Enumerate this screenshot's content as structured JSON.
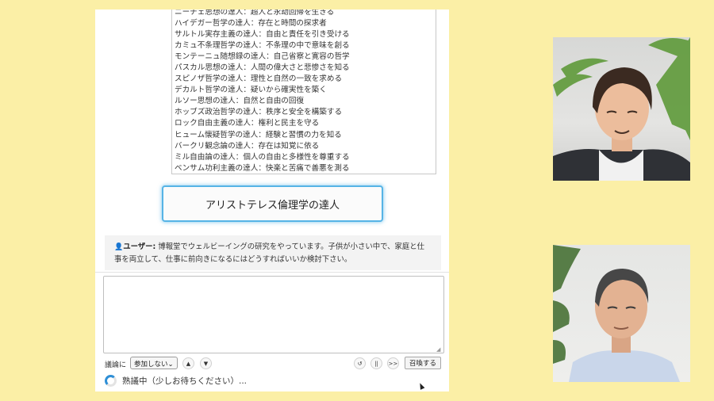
{
  "experts_list": [
    "ニーチェ思想の達人：超人と永劫回帰を生きる",
    "ハイデガー哲学の達人：存在と時間の探求者",
    "サルトル実存主義の達人：自由と責任を引き受ける",
    "カミュ不条理哲学の達人：不条理の中で意味を創る",
    "モンテーニュ随想録の達人：自己省察と寛容の哲学",
    "パスカル思想の達人：人間の偉大さと悲惨さを知る",
    "スピノザ哲学の達人：理性と自然の一致を求める",
    "デカルト哲学の達人：疑いから確実性を築く",
    "ルソー思想の達人：自然と自由の回復",
    "ホッブズ政治哲学の達人：秩序と安全を構築する",
    "ロック自由主義の達人：権利と民主を守る",
    "ヒューム懐疑哲学の達人：経験と習慣の力を知る",
    "バークリ観念論の達人：存在は知覚に依る",
    "ミル自由論の達人：個人の自由と多様性を尊重する",
    "ベンサム功利主義の達人：快楽と苦痛で善悪を測る"
  ],
  "selected_expert": "アリストテレス倫理学の達人",
  "message": {
    "speaker": "ユーザー:",
    "text": " 博報堂でウェルビーイングの研究をやっています。子供が小さい中で、家庭と仕事を両立して、仕事に前向きになるにはどうすればいいか検討下さい。"
  },
  "input": {
    "value": "",
    "placeholder": ""
  },
  "controls": {
    "discussion_label": "議論に",
    "mode_selected": "参加しない",
    "mode_chevron": "⌄",
    "up_symbol": "▲",
    "down_symbol": "▼",
    "reset_symbol": "↺",
    "pause_symbol": "||",
    "skip_symbol": ">>",
    "summon_label": "召喚する"
  },
  "status": {
    "text": "熟議中（少しお待ちください）..."
  },
  "colors": {
    "background": "#fbefa6",
    "accent": "#56b4e6",
    "spinner": "#2f8fd6"
  }
}
